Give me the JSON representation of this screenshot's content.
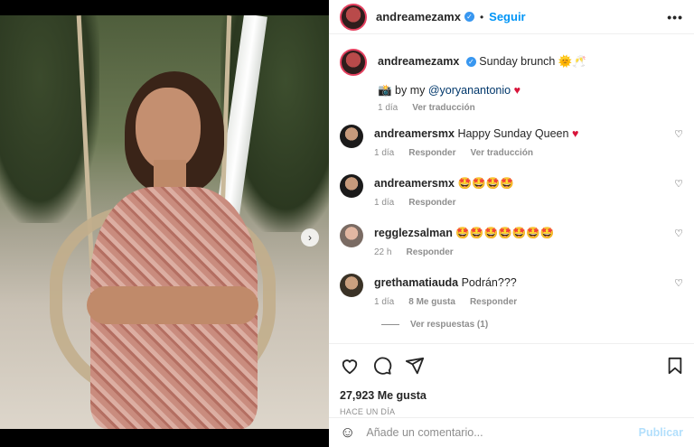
{
  "post": {
    "username": "andreamezamx",
    "follow_label": "Seguir",
    "separator": "•",
    "more_label": "•••",
    "caption": {
      "username": "andreamezamx",
      "text": "Sunday brunch 🌞🥂",
      "credit_prefix": "📸 by my",
      "credit_handle": "@yoryanantonio",
      "credit_suffix": "♥",
      "time": "1 día",
      "translate_label": "Ver traducción"
    },
    "comments": [
      {
        "username": "andreamersmx",
        "text": "Happy Sunday Queen",
        "emoji": "♥",
        "time": "1 día",
        "reply_label": "Responder",
        "translate_label": "Ver traducción"
      },
      {
        "username": "andreamersmx",
        "text": "🤩🤩🤩🤩",
        "time": "1 día",
        "reply_label": "Responder"
      },
      {
        "username": "regglezsalman",
        "text": "🤩🤩🤩🤩🤩🤩🤩",
        "time": "22 h",
        "reply_label": "Responder"
      },
      {
        "username": "grethamatiauda",
        "text": "Podrán???",
        "time": "1 día",
        "likes_label": "8 Me gusta",
        "reply_label": "Responder"
      }
    ],
    "view_replies_label": "Ver respuestas (1)",
    "likes_text": "27,923 Me gusta",
    "time_ago": "HACE UN DÍA",
    "comment_placeholder": "Añade un comentario...",
    "publish_label": "Publicar"
  },
  "colors": {
    "accent": "#0095f6",
    "heart": "#d8143a"
  },
  "icons": [
    "verified-icon",
    "heart-icon",
    "comment-icon",
    "share-icon",
    "bookmark-icon",
    "emoji-icon",
    "next-arrow-icon"
  ]
}
